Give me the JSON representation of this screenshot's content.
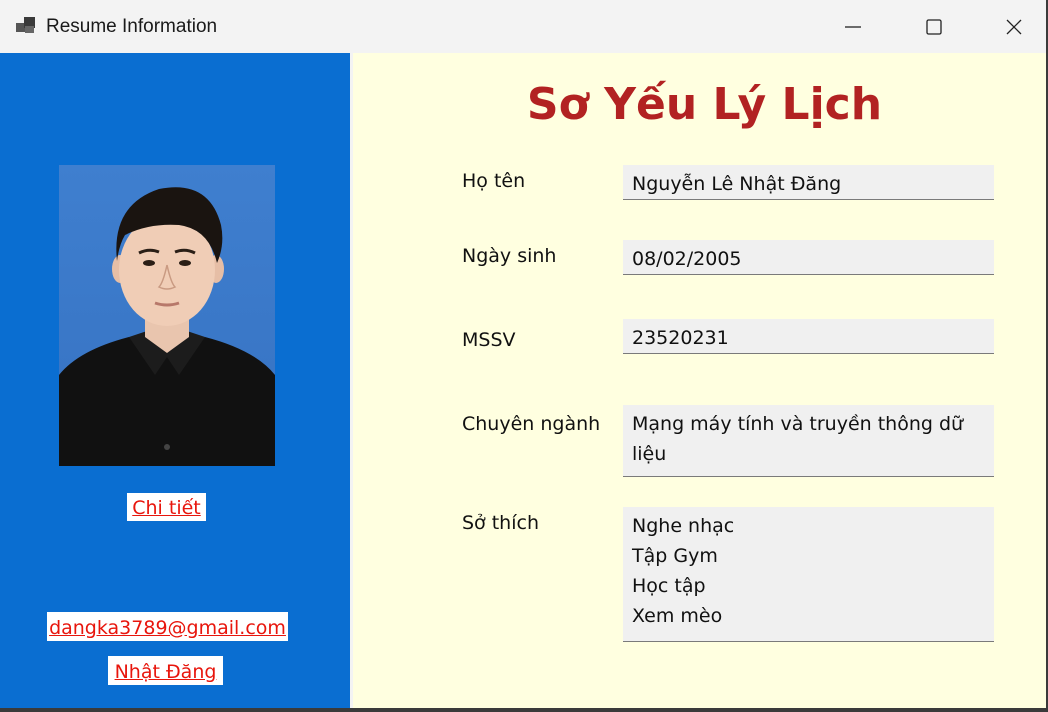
{
  "window": {
    "title": "Resume Information"
  },
  "sidebar": {
    "detail_link": "Chi tiết",
    "email_link": "dangka3789@gmail.com",
    "name_link": "Nhật Đăng"
  },
  "main": {
    "heading": "Sơ Yếu Lý Lịch",
    "fields": {
      "fullname": {
        "label": "Họ tên",
        "value": "Nguyễn Lê Nhật Đăng"
      },
      "birthday": {
        "label": "Ngày sinh",
        "value": "08/02/2005"
      },
      "student_id": {
        "label": "MSSV",
        "value": "23520231"
      },
      "major": {
        "label": "Chuyên ngành",
        "value": "Mạng máy tính và truyền thông dữ liệu"
      },
      "hobbies": {
        "label": "Sở thích",
        "value": "Nghe nhạc\nTập Gym\nHọc tập\nXem mèo"
      }
    }
  },
  "colors": {
    "sidebar_bg": "#0a6ed1",
    "content_bg": "#ffffe0",
    "heading": "#b22222",
    "link": "#e8150c"
  }
}
